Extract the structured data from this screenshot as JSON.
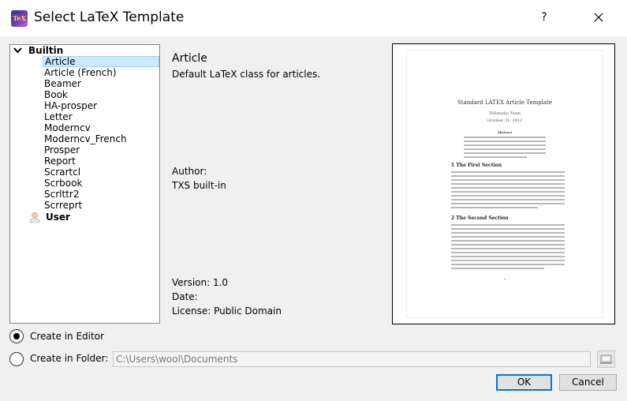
{
  "window": {
    "title": "Select LaTeX Template",
    "icon_text": "TeX",
    "help_label": "?"
  },
  "tree": {
    "groups": [
      {
        "label": "Builtin",
        "expanded": true,
        "items": [
          "Article",
          "Article (French)",
          "Beamer",
          "Book",
          "HA-prosper",
          "Letter",
          "Moderncv",
          "Moderncv_French",
          "Prosper",
          "Report",
          "Scrartcl",
          "Scrbook",
          "Scrlttr2",
          "Scrreprt"
        ],
        "selected": "Article"
      },
      {
        "label": "User",
        "expanded": false,
        "items": []
      }
    ]
  },
  "details": {
    "name": "Article",
    "description": "Default LaTeX class for articles.",
    "author_label": "Author:",
    "author": "TXS built-in",
    "version": "Version: 1.0",
    "date": "Date:",
    "license": "License: Public Domain"
  },
  "preview": {
    "title": "Standard LATEX Article Template",
    "author": "TeXstudio Team",
    "date": "October 31, 2012",
    "abstract_heading": "Abstract",
    "section1": "1   The First Section",
    "section2": "2   The Second Section",
    "page_number": "1"
  },
  "options": {
    "create_in_editor": "Create in Editor",
    "create_in_folder": "Create in Folder:",
    "selected": "create_in_editor",
    "folder_path": "C:\\Users\\wool\\Documents"
  },
  "buttons": {
    "ok": "OK",
    "cancel": "Cancel"
  },
  "colors": {
    "selection_bg": "#cde8ff",
    "selection_border": "#99d1ff",
    "default_button_border": "#0078d7"
  }
}
